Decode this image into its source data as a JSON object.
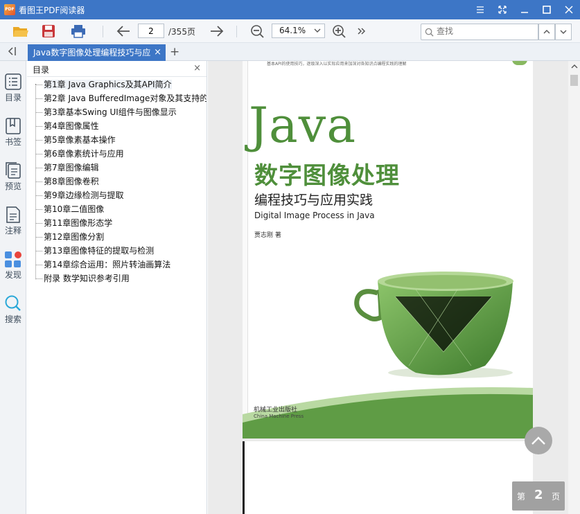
{
  "window": {
    "title": "看图王PDF阅读器",
    "logo_text": "PDF"
  },
  "toolbar": {
    "page_current": "2",
    "page_total": "/355页",
    "zoom": "64.1%",
    "search_placeholder": "查找"
  },
  "tab": {
    "label": "Java数字图像处理编程技巧与应",
    "close": "×",
    "add": "+"
  },
  "rail": {
    "items": [
      {
        "label": "目录",
        "icon": "list-icon"
      },
      {
        "label": "书签",
        "icon": "bookmark-icon"
      },
      {
        "label": "预览",
        "icon": "pages-icon"
      },
      {
        "label": "注释",
        "icon": "note-icon"
      },
      {
        "label": "发现",
        "icon": "apps-icon"
      },
      {
        "label": "搜索",
        "icon": "search-icon"
      }
    ]
  },
  "toc": {
    "title": "目录",
    "close": "×",
    "items": [
      "第1章 Java Graphics及其API简介",
      "第2章 Java BufferedImage对象及其支持的",
      "第3章基本Swing UI组件与图像显示",
      "第4章图像属性",
      "第5章像素基本操作",
      "第6章像素统计与应用",
      "第7章图像编辑",
      "第8章图像卷积",
      "第9章边缘检测与提取",
      "第10章二值图像",
      "第11章图像形态学",
      "第12章图像分割",
      "第13章图像特征的提取与检测",
      "第14章综合运用：照片转油画算法",
      "附录 数学知识参考引用"
    ]
  },
  "cover": {
    "top_note": "基本API的使用技巧，逐级深入以实际应用来加深对各知识点编程实践的理解",
    "java": "Java",
    "title_zh": "数字图像处理",
    "subtitle_zh": "编程技巧与应用实践",
    "title_en": "Digital Image Process in Java",
    "author": "贾志刚 著",
    "publisher_zh": "机械工业出版社",
    "publisher_en": "China Machine Press"
  },
  "page_indicator": {
    "prefix": "第",
    "number": "2",
    "suffix": "页"
  },
  "colors": {
    "accent": "#3d76c6",
    "cover_green": "#4f8f3b"
  }
}
